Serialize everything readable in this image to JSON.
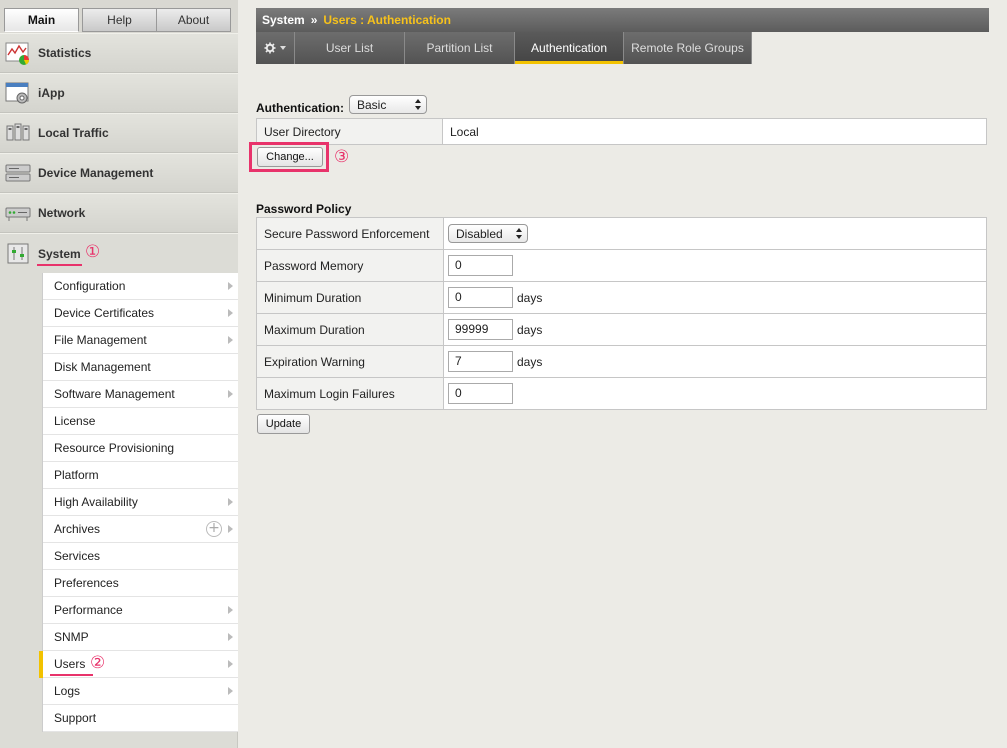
{
  "top_tabs": [
    "Main",
    "Help",
    "About"
  ],
  "nav": {
    "statistics": "Statistics",
    "iapp": "iApp",
    "local_traffic": "Local Traffic",
    "device_management": "Device Management",
    "network": "Network",
    "system": "System"
  },
  "submenu": [
    {
      "label": "Configuration",
      "arrow": true
    },
    {
      "label": "Device Certificates",
      "arrow": true
    },
    {
      "label": "File Management",
      "arrow": true
    },
    {
      "label": "Disk Management",
      "arrow": false
    },
    {
      "label": "Software Management",
      "arrow": true
    },
    {
      "label": "License",
      "arrow": false
    },
    {
      "label": "Resource Provisioning",
      "arrow": false
    },
    {
      "label": "Platform",
      "arrow": false
    },
    {
      "label": "High Availability",
      "arrow": true
    },
    {
      "label": "Archives",
      "arrow": true,
      "plus": true
    },
    {
      "label": "Services",
      "arrow": false
    },
    {
      "label": "Preferences",
      "arrow": false
    },
    {
      "label": "Performance",
      "arrow": true
    },
    {
      "label": "SNMP",
      "arrow": true
    },
    {
      "label": "Users",
      "arrow": true,
      "active": true
    },
    {
      "label": "Logs",
      "arrow": true
    },
    {
      "label": "Support",
      "arrow": false
    }
  ],
  "annotations": {
    "one": "①",
    "two": "②",
    "three": "③"
  },
  "header": {
    "root": "System",
    "separator": "»",
    "current": "Users : Authentication"
  },
  "tabs": [
    "User List",
    "Partition List",
    "Authentication",
    "Remote Role Groups"
  ],
  "auth": {
    "label": "Authentication:",
    "selected": "Basic",
    "dir_key": "User Directory",
    "dir_value": "Local",
    "change_button": "Change..."
  },
  "policy": {
    "title": "Password Policy",
    "rows": [
      {
        "key": "Secure Password Enforcement",
        "type": "select",
        "value": "Disabled"
      },
      {
        "key": "Password Memory",
        "type": "input",
        "value": "0",
        "unit": ""
      },
      {
        "key": "Minimum Duration",
        "type": "input",
        "value": "0",
        "unit": "days"
      },
      {
        "key": "Maximum Duration",
        "type": "input",
        "value": "99999",
        "unit": "days"
      },
      {
        "key": "Expiration Warning",
        "type": "input",
        "value": "7",
        "unit": "days"
      },
      {
        "key": "Maximum Login Failures",
        "type": "input",
        "value": "0",
        "unit": ""
      }
    ],
    "update_button": "Update"
  },
  "colors": {
    "accent": "#f2c200",
    "annotation": "#e8336b",
    "header_active": "#f7c21b"
  }
}
